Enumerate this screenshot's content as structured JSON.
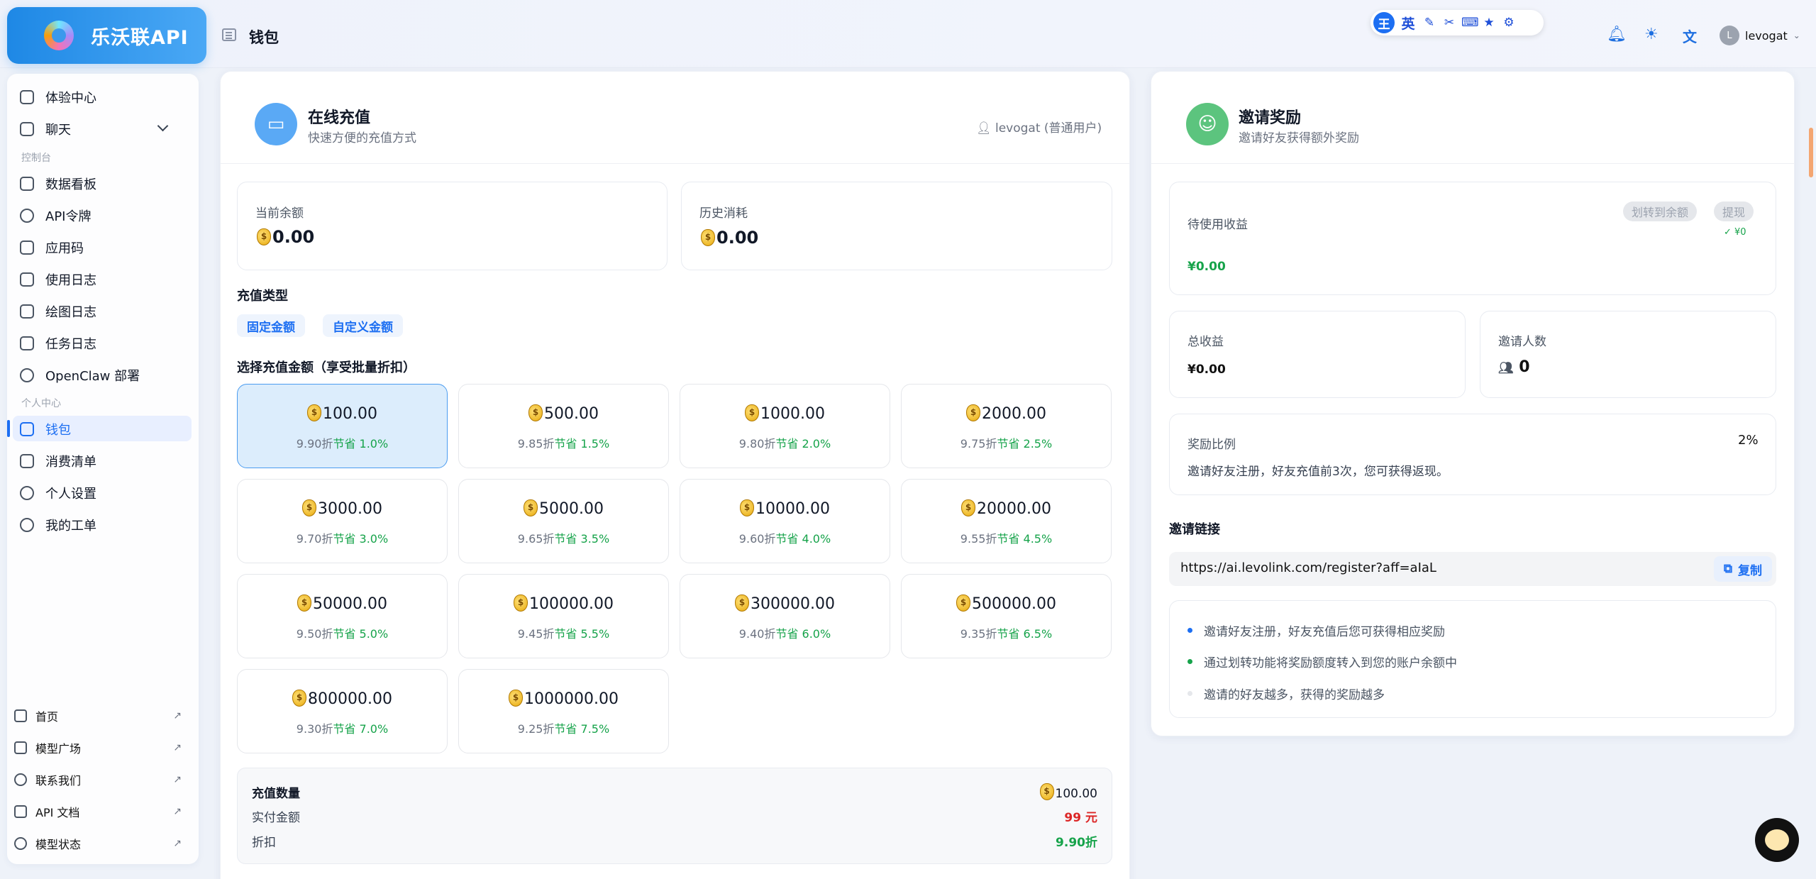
{
  "brand": {
    "name": "乐沃联API"
  },
  "page": {
    "title": "钱包"
  },
  "extension": {
    "badge": "王",
    "lang": "英",
    "tools": [
      "✎",
      "✂",
      "⌨",
      "★",
      "⚙"
    ]
  },
  "user": {
    "initial": "L",
    "name": "levogat"
  },
  "sidebar": {
    "items_top": [
      {
        "label": "体验中心"
      },
      {
        "label": "聊天"
      }
    ],
    "section_console": "控制台",
    "items_console": [
      {
        "label": "数据看板"
      },
      {
        "label": "API令牌"
      },
      {
        "label": "应用码"
      },
      {
        "label": "使用日志"
      },
      {
        "label": "绘图日志"
      },
      {
        "label": "任务日志"
      },
      {
        "label": "OpenClaw 部署"
      }
    ],
    "section_personal": "个人中心",
    "items_personal": [
      {
        "label": "钱包"
      },
      {
        "label": "消费清单"
      },
      {
        "label": "个人设置"
      },
      {
        "label": "我的工单"
      }
    ],
    "external": [
      {
        "label": "首页"
      },
      {
        "label": "模型广场"
      },
      {
        "label": "联系我们"
      },
      {
        "label": "API 文档"
      },
      {
        "label": "模型状态"
      }
    ],
    "arrow": "↗"
  },
  "recharge": {
    "title": "在线充值",
    "subtitle": "快速方便的充值方式",
    "user_tag": "levogat (普通用户)",
    "balance_label": "当前余额",
    "balance_value": "0.00",
    "history_label": "历史消耗",
    "history_value": "0.00",
    "type_label": "充值类型",
    "types": [
      "固定金额",
      "自定义金额"
    ],
    "amount_label": "选择充值金额（享受批量折扣）",
    "options": [
      {
        "amount": "100.00",
        "discount": "9.90折",
        "save": "节省 1.0%"
      },
      {
        "amount": "500.00",
        "discount": "9.85折",
        "save": "节省 1.5%"
      },
      {
        "amount": "1000.00",
        "discount": "9.80折",
        "save": "节省 2.0%"
      },
      {
        "amount": "2000.00",
        "discount": "9.75折",
        "save": "节省 2.5%"
      },
      {
        "amount": "3000.00",
        "discount": "9.70折",
        "save": "节省 3.0%"
      },
      {
        "amount": "5000.00",
        "discount": "9.65折",
        "save": "节省 3.5%"
      },
      {
        "amount": "10000.00",
        "discount": "9.60折",
        "save": "节省 4.0%"
      },
      {
        "amount": "20000.00",
        "discount": "9.55折",
        "save": "节省 4.5%"
      },
      {
        "amount": "50000.00",
        "discount": "9.50折",
        "save": "节省 5.0%"
      },
      {
        "amount": "100000.00",
        "discount": "9.45折",
        "save": "节省 5.5%"
      },
      {
        "amount": "300000.00",
        "discount": "9.40折",
        "save": "节省 6.0%"
      },
      {
        "amount": "500000.00",
        "discount": "9.35折",
        "save": "节省 6.5%"
      },
      {
        "amount": "800000.00",
        "discount": "9.30折",
        "save": "节省 7.0%"
      },
      {
        "amount": "1000000.00",
        "discount": "9.25折",
        "save": "节省 7.5%"
      }
    ],
    "summary": {
      "qty_label": "充值数量",
      "qty_value": "100.00",
      "pay_label": "实付金额",
      "pay_value": "99 元",
      "disc_label": "折扣",
      "disc_value": "9.90折"
    }
  },
  "invite": {
    "title": "邀请奖励",
    "subtitle": "邀请好友获得额外奖励",
    "pending_label": "待使用收益",
    "pending_value": "¥0.00",
    "transfer_btn": "划转到余额",
    "withdraw_btn": "提现",
    "withdraw_note": "✓ ¥0",
    "total_label": "总收益",
    "total_value": "¥0.00",
    "count_label": "邀请人数",
    "count_value": "0",
    "ratio_label": "奖励比例",
    "ratio_value": "2%",
    "ratio_desc": "邀请好友注册，好友充值前3次，您可获得返现。",
    "link_label": "邀请链接",
    "link_value": "https://ai.levolink.com/register?aff=aIaL",
    "copy_label": "复制",
    "tips": [
      "邀请好友注册，好友充值后您可获得相应奖励",
      "通过划转功能将奖励额度转入到您的账户余额中",
      "邀请的好友越多，获得的奖励越多"
    ]
  },
  "colors": {
    "accent": "#1d6ff2",
    "success": "#16a34a",
    "danger": "#dc2626",
    "recharge_icon": "#5aa9f5",
    "invite_icon": "#5cc47e"
  }
}
